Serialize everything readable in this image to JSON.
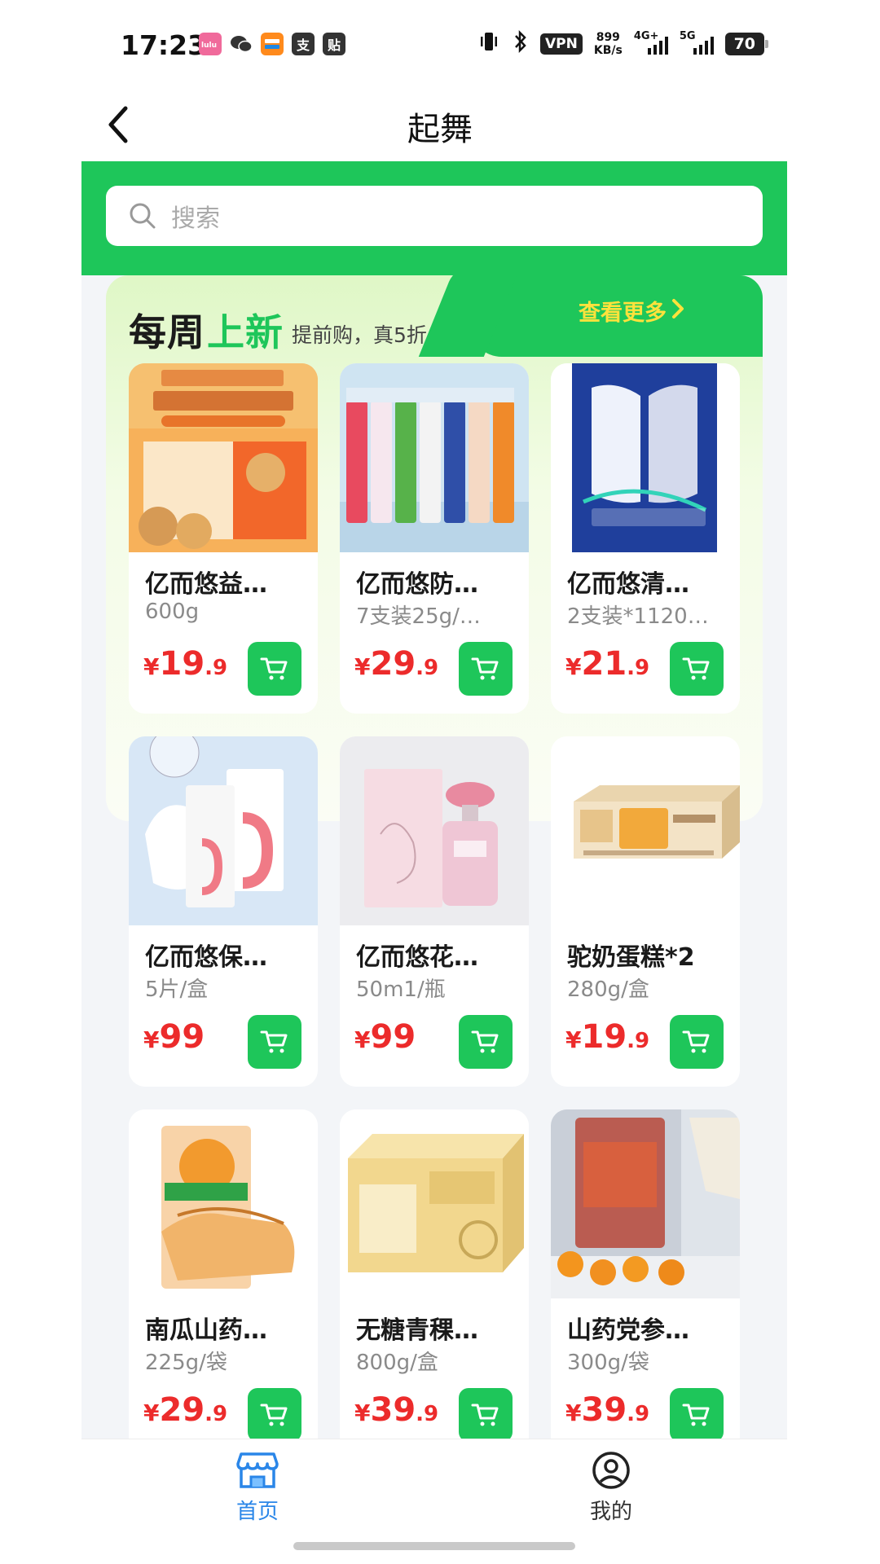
{
  "status_bar": {
    "time": "17:23",
    "app_icons": [
      {
        "name": "lulu-app-icon",
        "text": "lulu",
        "color": "#f06a9b"
      },
      {
        "name": "wechat-icon",
        "text": "",
        "color": "#333333"
      },
      {
        "name": "taobao-app-icon",
        "text": "",
        "color": "#ff8a1c"
      },
      {
        "name": "alipay-icon",
        "text": "支",
        "color": "#333333"
      },
      {
        "name": "sticker-app-icon",
        "text": "贴",
        "color": "#333333"
      }
    ],
    "vpn": "VPN",
    "speed_value": "899",
    "speed_unit": "KB/s",
    "signal_1": "4G+",
    "signal_2": "5G",
    "battery": "70"
  },
  "header": {
    "title": "起舞"
  },
  "search": {
    "placeholder": "搜索"
  },
  "weekly": {
    "title_part1": "每周",
    "title_part2": "上新",
    "subtitle": "提前购，真5折",
    "see_more": "查看更多"
  },
  "products": [
    {
      "name": "亿而悠益…",
      "spec": "600g",
      "price_int": "19",
      "price_dec": ".9"
    },
    {
      "name": "亿而悠防…",
      "spec": "7支装25g/…",
      "price_int": "29",
      "price_dec": ".9"
    },
    {
      "name": "亿而悠清…",
      "spec": "2支装*1120…",
      "price_int": "21",
      "price_dec": ".9"
    },
    {
      "name": "亿而悠保…",
      "spec": "5片/盒",
      "price_int": "99",
      "price_dec": ""
    },
    {
      "name": "亿而悠花…",
      "spec": "50m1/瓶",
      "price_int": "99",
      "price_dec": ""
    },
    {
      "name": "驼奶蛋糕*2",
      "spec": "280g/盒",
      "price_int": "19",
      "price_dec": ".9"
    },
    {
      "name": "南瓜山药…",
      "spec": "225g/袋",
      "price_int": "29",
      "price_dec": ".9"
    },
    {
      "name": "无糖青稞…",
      "spec": "800g/盒",
      "price_int": "39",
      "price_dec": ".9"
    },
    {
      "name": "山药党参…",
      "spec": "300g/袋",
      "price_int": "39",
      "price_dec": ".9"
    }
  ],
  "currency": "¥",
  "nav": {
    "home": "首页",
    "mine": "我的"
  },
  "colors": {
    "brand_green": "#1ec65a",
    "price_red": "#ec2b2b",
    "nav_active": "#2a86e8"
  }
}
